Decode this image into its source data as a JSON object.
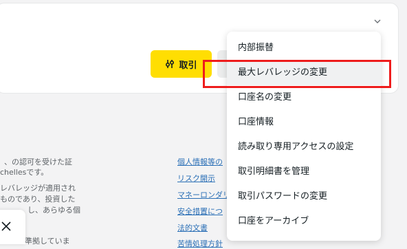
{
  "card": {
    "chevron_icon": "chevron-down-icon",
    "trade_button": {
      "icon": "sliders-icon",
      "label": "取引"
    }
  },
  "footer": {
    "left_text": [
      "、の認可を受けた証",
      "chellesです。",
      "レバレッジが適用され",
      "ものであり、投資した",
      "し、あらゆる個",
      "準拠していま"
    ],
    "links": [
      "個人情報等の",
      "リスク開示",
      "マネーロンダリン",
      "安全措置につ",
      "法的文書",
      "苦情処理方針"
    ]
  },
  "close_icon": "close-icon",
  "menu": {
    "items": [
      "内部振替",
      "最大レバレッジの変更",
      "口座名の変更",
      "口座情報",
      "読み取り専用アクセスの設定",
      "取引明細書を管理",
      "取引パスワードの変更",
      "口座をアーカイブ"
    ],
    "highlighted_index": 1
  },
  "colors": {
    "accent_yellow": "#ffde02",
    "highlight_box": "#ee1c1c",
    "link": "#2a6fb6"
  }
}
